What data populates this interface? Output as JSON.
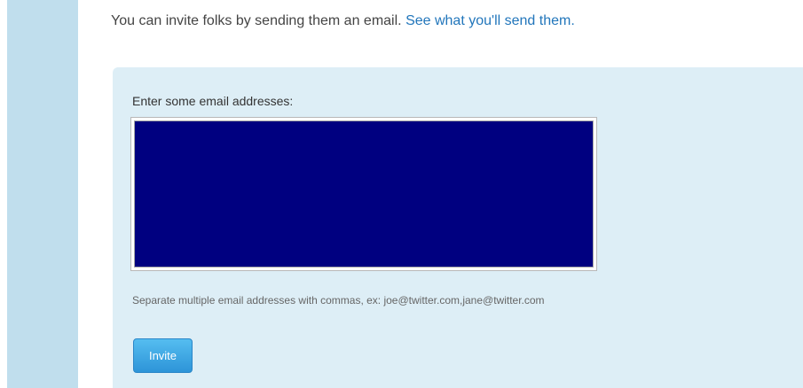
{
  "intro": {
    "text": "You can invite folks by sending them an email.",
    "link_label": "See what you'll send them."
  },
  "invite_form": {
    "label": "Enter some email addresses:",
    "textarea_value": "",
    "hint": "Separate multiple email addresses with commas, ex: joe@twitter.com,jane@twitter.com",
    "invite_label": "Invite"
  },
  "colors": {
    "sidebar": "#c0deed",
    "panel": "#ddeef6",
    "link": "#2276bb",
    "textarea_fill": "#000080",
    "button": "#2d94d8"
  }
}
